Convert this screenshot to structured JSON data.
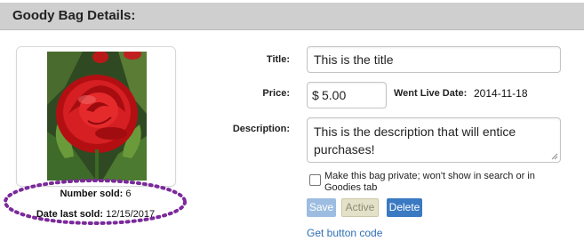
{
  "header": {
    "title": "Goody Bag Details:"
  },
  "stats": {
    "number_sold_label": "Number sold:",
    "number_sold_value": "6",
    "date_last_sold_label": "Date last sold:",
    "date_last_sold_value": "12/15/2017"
  },
  "form": {
    "title_label": "Title:",
    "title_value": "This is the title",
    "price_label": "Price:",
    "price_currency": "$",
    "price_value": "5.00",
    "went_live_label": "Went Live Date:",
    "went_live_value": "2014-11-18",
    "description_label": "Description:",
    "description_value": "This is the description that will entice purchases!",
    "private_label": "Make this bag private; won't show in search or in Goodies tab",
    "private_checked": false
  },
  "buttons": {
    "save": "Save",
    "active": "Active",
    "delete": "Delete"
  },
  "link": {
    "get_button_code": "Get button code"
  },
  "colors": {
    "header_bg": "#cfcfcf",
    "accent_blue": "#3b79c3",
    "link_blue": "#2f6fb3",
    "annotation_purple": "#7b2a9b"
  }
}
